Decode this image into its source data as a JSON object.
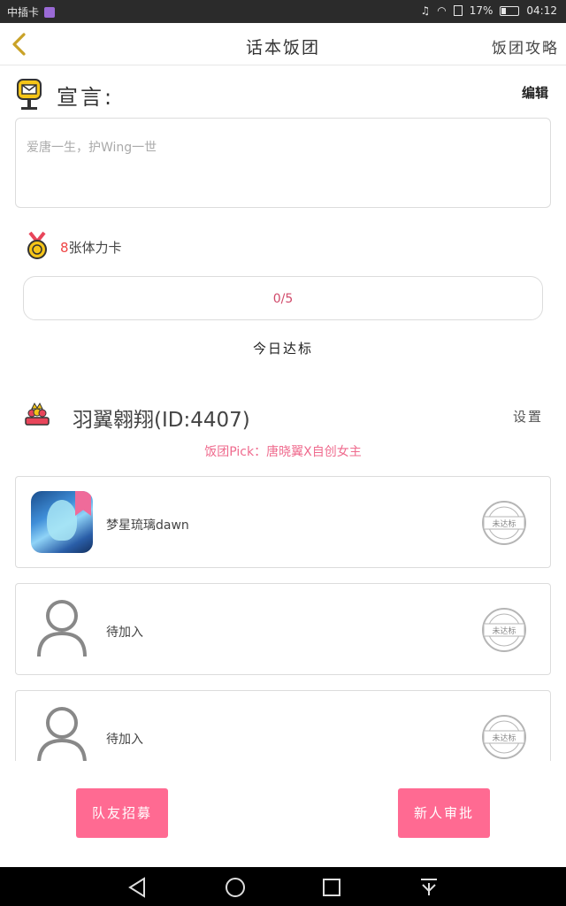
{
  "status_bar": {
    "carrier": "中插卡",
    "battery": "17%",
    "time": "04:12"
  },
  "header": {
    "title": "话本饭团",
    "guide_label": "饭团攻略"
  },
  "declaration": {
    "title": "宣言:",
    "edit_label": "编辑",
    "text": "爱唐一生，护Wing一世"
  },
  "energy": {
    "count": "8",
    "label": "张体力卡"
  },
  "progress": {
    "text": "0/5",
    "fraction": 0,
    "caption": "今日达标"
  },
  "team": {
    "name": "羽翼翱翔(ID:4407)",
    "settings_label": "设置",
    "pick": "饭团Pick：唐晓翼X自创女主"
  },
  "members": [
    {
      "name": "梦星琉璃dawn",
      "status": "未达标",
      "has_avatar": true
    },
    {
      "name": "待加入",
      "status": "未达标",
      "has_avatar": false
    },
    {
      "name": "待加入",
      "status": "未达标",
      "has_avatar": false
    }
  ],
  "buttons": {
    "recruit": "队友招募",
    "approve": "新人审批"
  },
  "colors": {
    "accent_pink": "#ff6a92",
    "pick_pink": "#ef6b8e",
    "back_arrow": "#c9a227",
    "stamp_gray": "#b5b5b5"
  },
  "icons": {
    "back": "chevron-left-icon",
    "declaration": "mailbox-icon",
    "energy": "medal-icon",
    "team": "crown-group-icon",
    "placeholder": "person-icon",
    "stamp": "stamp-icon",
    "nav_back": "triangle-back-icon",
    "nav_home": "circle-home-icon",
    "nav_recent": "square-recent-icon",
    "nav_down": "pull-down-icon"
  }
}
